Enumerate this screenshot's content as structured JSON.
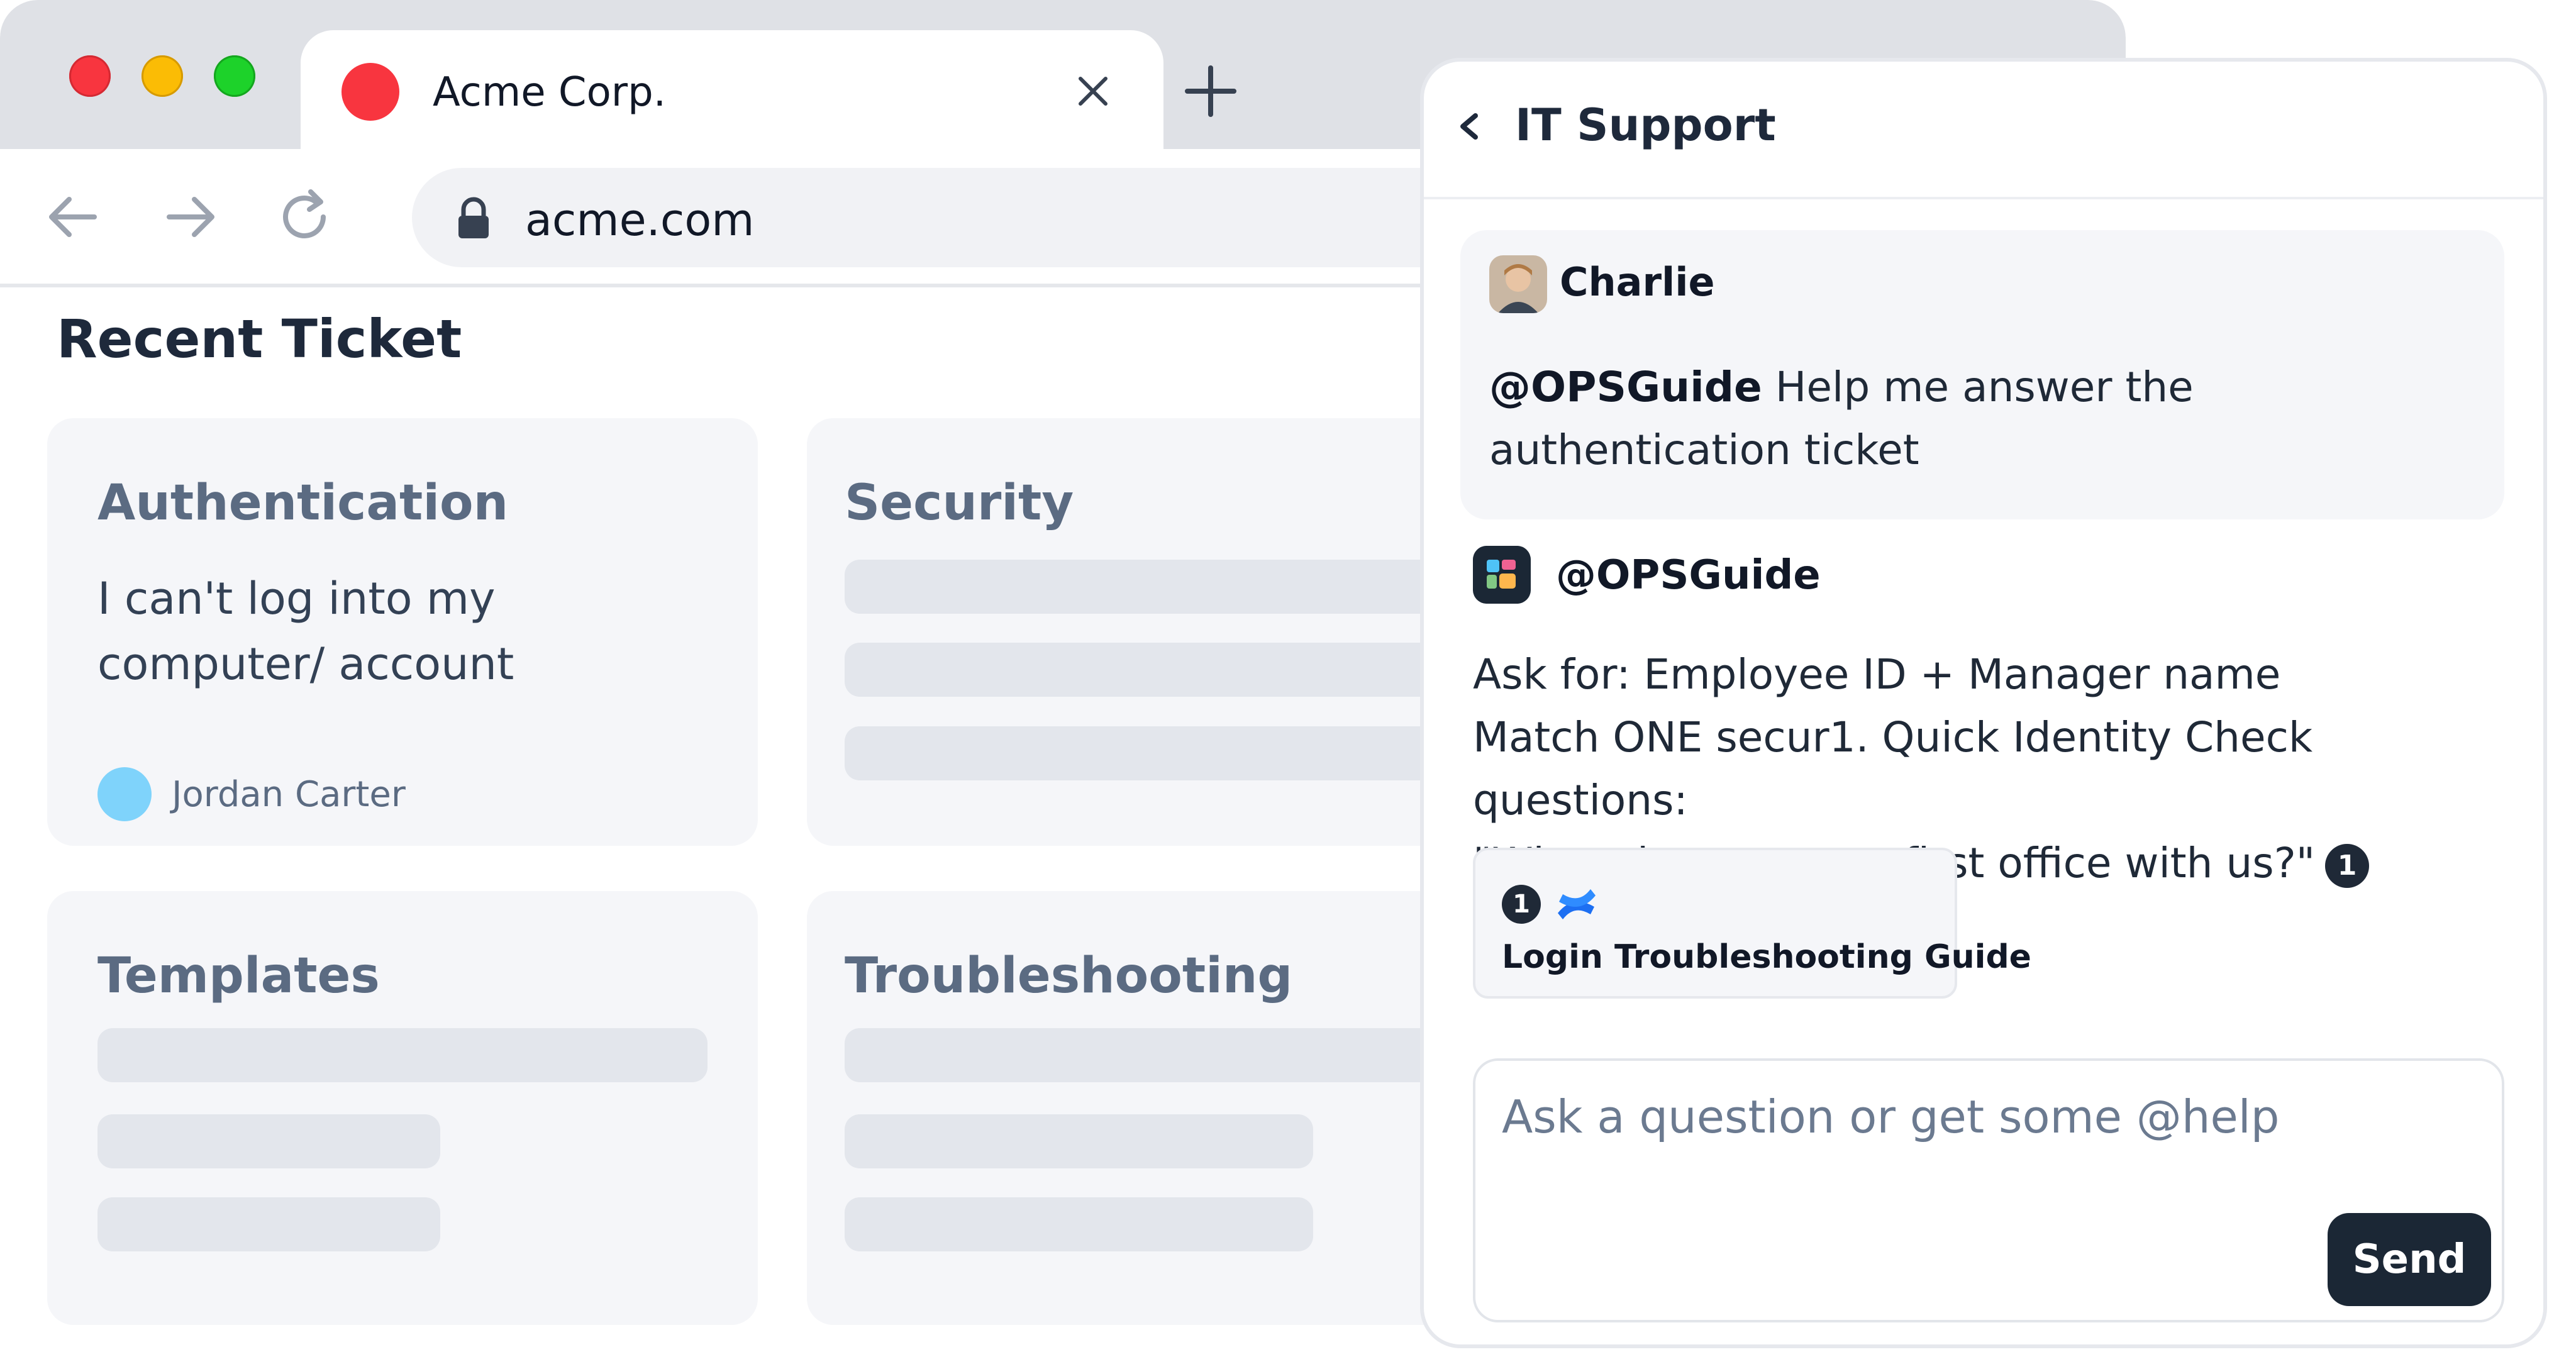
{
  "browser": {
    "tab": {
      "title": "Acme Corp."
    },
    "address": {
      "url": "acme.com"
    }
  },
  "page": {
    "heading": "Recent Ticket",
    "cards": [
      {
        "title": "Authentication",
        "body": "I can't log into my computer/ account",
        "user": "Jordan Carter"
      },
      {
        "title": "Security"
      },
      {
        "title": "Templates"
      },
      {
        "title": "Troubleshooting"
      }
    ]
  },
  "chat": {
    "title": "IT Support",
    "user_message": {
      "author": "Charlie",
      "mention": "@OPSGuide",
      "text": "Help me answer the authentication ticket"
    },
    "bot_message": {
      "author": "@OPSGuide",
      "line1": "Ask for: Employee ID + Manager name",
      "line2": "Match ONE secur1. Quick Identity Check questions:",
      "line3": "\"What city was your first office with us?\"",
      "citation": "1"
    },
    "source": {
      "number": "1",
      "title": "Login Troubleshooting Guide"
    },
    "composer": {
      "placeholder": "Ask a question or get some @help",
      "send_label": "Send"
    }
  },
  "colors": {
    "traffic_red": "#f8353f",
    "traffic_yellow": "#fbbc05",
    "traffic_green": "#1dd22a",
    "send_button": "#1b2735",
    "user_avatar": "#7fd3fb"
  },
  "icons": [
    "close-icon",
    "plus-icon",
    "back-arrow-icon",
    "forward-arrow-icon",
    "reload-icon",
    "lock-icon",
    "chevron-left-icon",
    "confluence-icon",
    "ops-guide-icon"
  ]
}
